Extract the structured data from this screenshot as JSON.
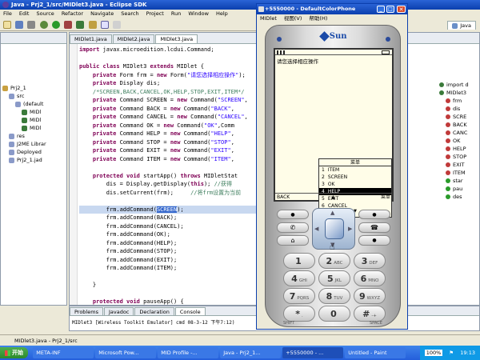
{
  "eclipse": {
    "title": "Java - Prj2_1/src/MIDlet3.java - Eclipse SDK",
    "menu": [
      "File",
      "Edit",
      "Source",
      "Refactor",
      "Navigate",
      "Search",
      "Project",
      "Run",
      "Window",
      "Help"
    ],
    "perspective": "Java",
    "editor_tabs": [
      "MIDlet1.java",
      "MIDlet2.java",
      "MIDlet3.java"
    ],
    "active_tab_index": 2,
    "code_lines": [
      "import javax.microedition.lcdui.Command;",
      "",
      "public class MIDlet3 extends MIDlet {",
      "    private Form frm = new Form(\"请您选择相应操作\");",
      "    private Display dis;",
      "    /*SCREEN,BACK,CANCEL,OK,HELP,STOP,EXIT,ITEM*/",
      "    private Command SCREEN = new Command(\"SCREEN\",",
      "    private Command BACK = new Command(\"BACK\",",
      "    private Command CANCEL = new Command(\"CANCEL\",",
      "    private Command OK = new Command(\"OK\",Comm",
      "    private Command HELP = new Command(\"HELP\",",
      "    private Command STOP = new Command(\"STOP\",",
      "    private Command EXIT = new Command(\"EXIT\",",
      "    private Command ITEM = new Command(\"ITEM\",",
      "",
      "    protected void startApp() throws MIDletStat",
      "        dis = Display.getDisplay(this); //获得",
      "        dis.setCurrent(frm);     //将frm设置为当前",
      "",
      "        frm.addCommand(SCREEN);",
      "        frm.addCommand(BACK);",
      "        frm.addCommand(CANCEL);",
      "        frm.addCommand(OK);",
      "        frm.addCommand(HELP);",
      "        frm.addCommand(STOP);",
      "        frm.addCommand(EXIT);",
      "        frm.addCommand(ITEM);",
      "",
      "    }",
      "",
      "    protected void pauseApp() {"
    ],
    "tree": [
      {
        "label": "Prj2_1",
        "depth": 0
      },
      {
        "label": "src",
        "depth": 1
      },
      {
        "label": "(default",
        "depth": 2
      },
      {
        "label": "MIDl",
        "depth": 3
      },
      {
        "label": "MIDl",
        "depth": 3
      },
      {
        "label": "MIDl",
        "depth": 3
      },
      {
        "label": "res",
        "depth": 1
      },
      {
        "label": "J2ME Librar",
        "depth": 1
      },
      {
        "label": "Deployed",
        "depth": 1
      },
      {
        "label": "Prj2_1.jad",
        "depth": 1
      }
    ],
    "outline": [
      "import d",
      "MIDlet3",
      "frm",
      "dis",
      "SCRE",
      "BACK",
      "CANC",
      "OK",
      "HELP",
      "STOP",
      "EXIT",
      "ITEM",
      "star",
      "pau",
      "des"
    ],
    "bottom_tabs": [
      "Problems",
      "Javadoc",
      "Declaration",
      "Console"
    ],
    "console_line": "MIDlet3 [Wireless Toolkit Emulator] cmd 08-3-12 下午7:12)",
    "status_text": "MIDlet3.java - Prj2_1/src"
  },
  "emulator": {
    "title": "+5550000 - DefaultColorPhone",
    "menu": [
      "MIDlet",
      "视图(V)",
      "帮助(H)"
    ],
    "brand": "Sun",
    "form_title": "请您选择相应操作",
    "menu_header": "菜单",
    "menu_items": [
      {
        "num": "1",
        "label": "ITEM"
      },
      {
        "num": "2",
        "label": "SCREEN"
      },
      {
        "num": "3",
        "label": "OK"
      },
      {
        "num": "4",
        "label": "HELP"
      },
      {
        "num": "5",
        "label": "EXIT"
      },
      {
        "num": "6",
        "label": "CANCEL"
      }
    ],
    "selected_index": 3,
    "softkey_left": "BACK",
    "softkey_right": "菜单",
    "keys": [
      {
        "main": "1",
        "sub": ""
      },
      {
        "main": "2",
        "sub": "ABC"
      },
      {
        "main": "3",
        "sub": "DEF"
      },
      {
        "main": "4",
        "sub": "GHI"
      },
      {
        "main": "5",
        "sub": "JKL"
      },
      {
        "main": "6",
        "sub": "MNO"
      },
      {
        "main": "7",
        "sub": "PQRS"
      },
      {
        "main": "8",
        "sub": "TUV"
      },
      {
        "main": "9",
        "sub": "WXYZ"
      },
      {
        "main": "*",
        "sub": "."
      },
      {
        "main": "0",
        "sub": ""
      },
      {
        "main": "#",
        "sub": "-+"
      }
    ],
    "shift_label": "SHIFT",
    "space_label": "SPACE"
  },
  "taskbar": {
    "start": "开始",
    "tasks": [
      "META-INF",
      "Microsoft Pow...",
      "MID Profile -...",
      "Java - Prj2_1...",
      "+5550000 - ...",
      "Untitled - Paint"
    ],
    "tray": [
      "100%",
      "19:13"
    ]
  },
  "colors": {
    "accent": "#0b3fae",
    "selection": "#3366cc",
    "keyword": "#7f0055",
    "string": "#2a00ff",
    "comment": "#3f7f5f"
  }
}
